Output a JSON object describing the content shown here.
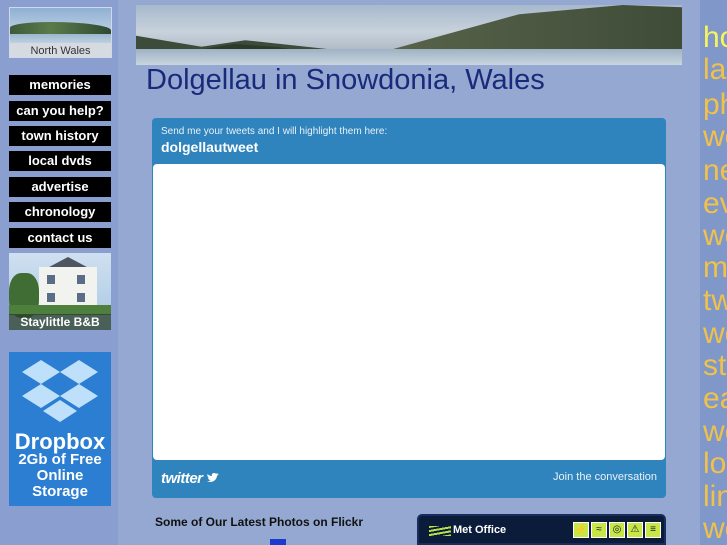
{
  "sidebar": {
    "north_wales_caption": "North Wales",
    "nav": [
      "memories",
      "can you help?",
      "town history",
      "local dvds",
      "advertise",
      "chronology",
      "contact us"
    ],
    "staylittle_label": "Staylittle B&B",
    "dropbox": {
      "brand": "Dropbox",
      "offer_line1": "2Gb of Free",
      "offer_line2": "Online",
      "offer_line3": "Storage"
    }
  },
  "header": {
    "title": "Dolgellau in Snowdonia, Wales"
  },
  "twitter": {
    "intro": "Send me your tweets and I will highlight them here:",
    "handle": "dolgellautweet",
    "logo": "twitter",
    "join": "Join the conversation"
  },
  "flickr": {
    "heading": "Some of Our Latest Photos on Flickr"
  },
  "metoffice": {
    "name": "Met Office"
  },
  "right_nav": [
    "ho",
    "la",
    "ph",
    "we",
    "ne",
    "ev",
    "we",
    "m",
    "tw",
    "we",
    "st",
    "ea",
    "we",
    "lo",
    "lin",
    "we"
  ],
  "colors": {
    "page_bg": "#94a8d2",
    "title": "#1a2a7a",
    "twitter_blue": "#2f84be",
    "right_link": "#f0c24a",
    "right_link_active": "#f7f55a"
  }
}
